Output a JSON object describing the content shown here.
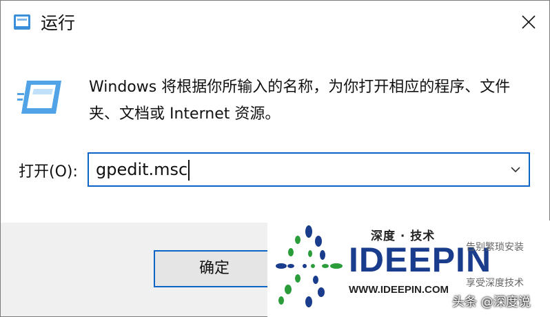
{
  "window": {
    "title": "运行",
    "close_icon": "close-icon"
  },
  "content": {
    "description": "Windows 将根据你所输入的名称，为你打开相应的程序、文件夹、文档或 Internet 资源。",
    "open_label": "打开(O):",
    "open_value": "gpedit.msc"
  },
  "footer": {
    "ok_label": "确定"
  },
  "watermark": {
    "top_text": "深度 · 技术",
    "brand": "IDEEPIN",
    "url": "WWW.IDEEPIN.COM",
    "right_top": "告别繁琐安装",
    "right_bottom": "享受深度技术",
    "credit": "头条 @深度说"
  },
  "colors": {
    "accent": "#0a64c8",
    "brand_blue": "#1a3c8c"
  }
}
